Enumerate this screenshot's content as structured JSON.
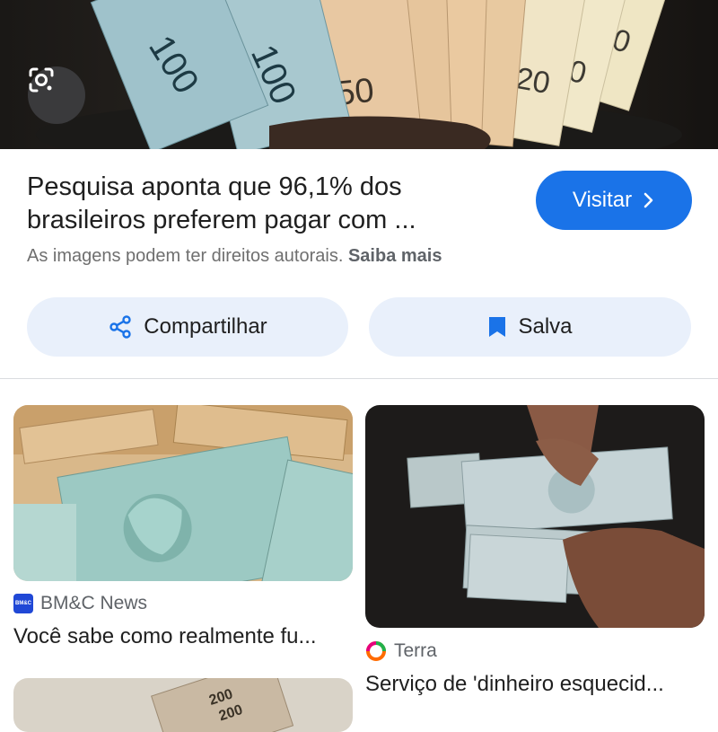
{
  "hero": {
    "image_name": "brazilian-real-banknotes-fan",
    "note_labels": [
      "100",
      "100",
      "50",
      "50",
      "50",
      "50",
      "20",
      "20",
      "20"
    ]
  },
  "result": {
    "title_line1": "Pesquisa aponta que 96,1% dos",
    "title_line2": "brasileiros preferem pagar com ...",
    "visit_label": "Visitar",
    "copyright_text": "As imagens podem ter direitos autorais.",
    "learn_more": "Saiba mais"
  },
  "actions": {
    "share_label": "Compartilhar",
    "save_label": "Salva"
  },
  "related": [
    {
      "source": "BM&C News",
      "favicon_text": "BM&C",
      "title": "Você sabe como realmente fu..."
    },
    {
      "source": "Terra",
      "title": "Serviço de 'dinheiro esquecid..."
    },
    {
      "note_labels": [
        "200",
        "200"
      ]
    }
  ],
  "colors": {
    "accent": "#1a73e8",
    "pill_bg": "#e9f0fb",
    "text_primary": "#1f1f1f",
    "text_secondary": "#5f6368"
  }
}
